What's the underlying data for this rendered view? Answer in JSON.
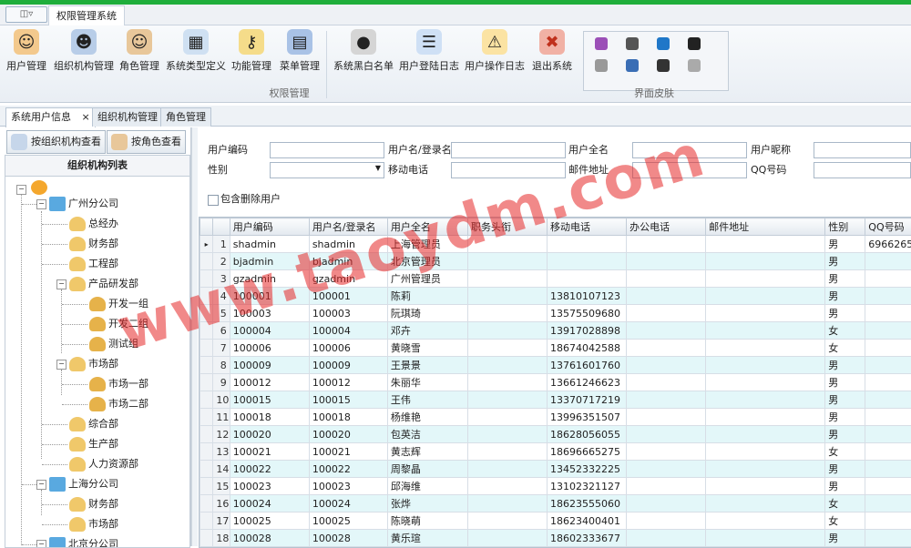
{
  "app": {
    "tab_title": "权限管理系统",
    "quick_access": "◫▿"
  },
  "ribbon": {
    "buttons": [
      {
        "label": "用户管理",
        "icon": "user-icon",
        "color": "#e39b3a"
      },
      {
        "label": "组织机构管理",
        "icon": "org-icon",
        "color": "#4a7fc0"
      },
      {
        "label": "角色管理",
        "icon": "role-icon",
        "color": "#c47a2c"
      },
      {
        "label": "系统类型定义",
        "icon": "system-type-icon",
        "color": "#7aa8d8"
      },
      {
        "label": "功能管理",
        "icon": "key-icon",
        "color": "#e0a928"
      },
      {
        "label": "菜单管理",
        "icon": "menu-book-icon",
        "color": "#3a6eb5"
      },
      {
        "label": "系统黑白名单",
        "icon": "blacklist-icon",
        "color": "#444444"
      },
      {
        "label": "用户登陆日志",
        "icon": "login-log-icon",
        "color": "#3a7fd0"
      },
      {
        "label": "用户操作日志",
        "icon": "warning-icon",
        "color": "#f0b020"
      },
      {
        "label": "退出系统",
        "icon": "exit-icon",
        "color": "#d9442b"
      }
    ],
    "group1_label": "权限管理",
    "group2_label": "界面皮肤"
  },
  "doc_tabs": [
    {
      "label": "系统用户信息"
    },
    {
      "label": "组织机构管理"
    },
    {
      "label": "角色管理"
    }
  ],
  "left_panel": {
    "btn_org": "按组织机构查看",
    "btn_role": "按角色查看",
    "list_title": "组织机构列表",
    "tree": [
      {
        "label": "广州分公司"
      },
      {
        "label": "总经办"
      },
      {
        "label": "财务部"
      },
      {
        "label": "工程部"
      },
      {
        "label": "产品研发部"
      },
      {
        "label": "开发一组"
      },
      {
        "label": "开发二组"
      },
      {
        "label": "测试组"
      },
      {
        "label": "市场部"
      },
      {
        "label": "市场一部"
      },
      {
        "label": "市场二部"
      },
      {
        "label": "综合部"
      },
      {
        "label": "生产部"
      },
      {
        "label": "人力资源部"
      },
      {
        "label": "上海分公司"
      },
      {
        "label": "财务部"
      },
      {
        "label": "市场部"
      },
      {
        "label": "北京分公司"
      }
    ]
  },
  "search": {
    "user_code": "用户编码",
    "username": "用户名/登录名",
    "fullname": "用户全名",
    "nickname": "用户昵称",
    "gender": "性别",
    "mobile": "移动电话",
    "email": "邮件地址",
    "qq": "QQ号码",
    "include_deleted": "包含删除用户"
  },
  "grid": {
    "columns": [
      "用户编码",
      "用户名/登录名",
      "用户全名",
      "职务头衔",
      "移动电话",
      "办公电话",
      "邮件地址",
      "性别",
      "QQ号码"
    ],
    "rows": [
      [
        "shadmin",
        "shadmin",
        "上海管理员",
        "",
        "",
        "",
        "",
        "男",
        "6966265"
      ],
      [
        "bjadmin",
        "bjadmin",
        "北京管理员",
        "",
        "",
        "",
        "",
        "男",
        ""
      ],
      [
        "gzadmin",
        "gzadmin",
        "广州管理员",
        "",
        "",
        "",
        "",
        "男",
        ""
      ],
      [
        "100001",
        "100001",
        "陈莉",
        "",
        "13810107123",
        "",
        "",
        "男",
        ""
      ],
      [
        "100003",
        "100003",
        "阮琪琦",
        "",
        "13575509680",
        "",
        "",
        "男",
        ""
      ],
      [
        "100004",
        "100004",
        "邓卉",
        "",
        "13917028898",
        "",
        "",
        "女",
        ""
      ],
      [
        "100006",
        "100006",
        "黄晓雪",
        "",
        "18674042588",
        "",
        "",
        "女",
        ""
      ],
      [
        "100009",
        "100009",
        "王景景",
        "",
        "13761601760",
        "",
        "",
        "男",
        ""
      ],
      [
        "100012",
        "100012",
        "朱丽华",
        "",
        "13661246623",
        "",
        "",
        "男",
        ""
      ],
      [
        "100015",
        "100015",
        "王伟",
        "",
        "13370717219",
        "",
        "",
        "男",
        ""
      ],
      [
        "100018",
        "100018",
        "杨维艳",
        "",
        "13996351507",
        "",
        "",
        "男",
        ""
      ],
      [
        "100020",
        "100020",
        "包英洁",
        "",
        "18628056055",
        "",
        "",
        "男",
        ""
      ],
      [
        "100021",
        "100021",
        "黄志辉",
        "",
        "18696665275",
        "",
        "",
        "女",
        ""
      ],
      [
        "100022",
        "100022",
        "周黎晶",
        "",
        "13452332225",
        "",
        "",
        "男",
        ""
      ],
      [
        "100023",
        "100023",
        "邱海维",
        "",
        "13102321127",
        "",
        "",
        "男",
        ""
      ],
      [
        "100024",
        "100024",
        "张烨",
        "",
        "18623555060",
        "",
        "",
        "女",
        ""
      ],
      [
        "100025",
        "100025",
        "陈晓萌",
        "",
        "18623400401",
        "",
        "",
        "女",
        ""
      ],
      [
        "100028",
        "100028",
        "黄乐瑄",
        "",
        "18602333677",
        "",
        "",
        "男",
        ""
      ]
    ]
  },
  "watermark": "www.taoydm.com"
}
